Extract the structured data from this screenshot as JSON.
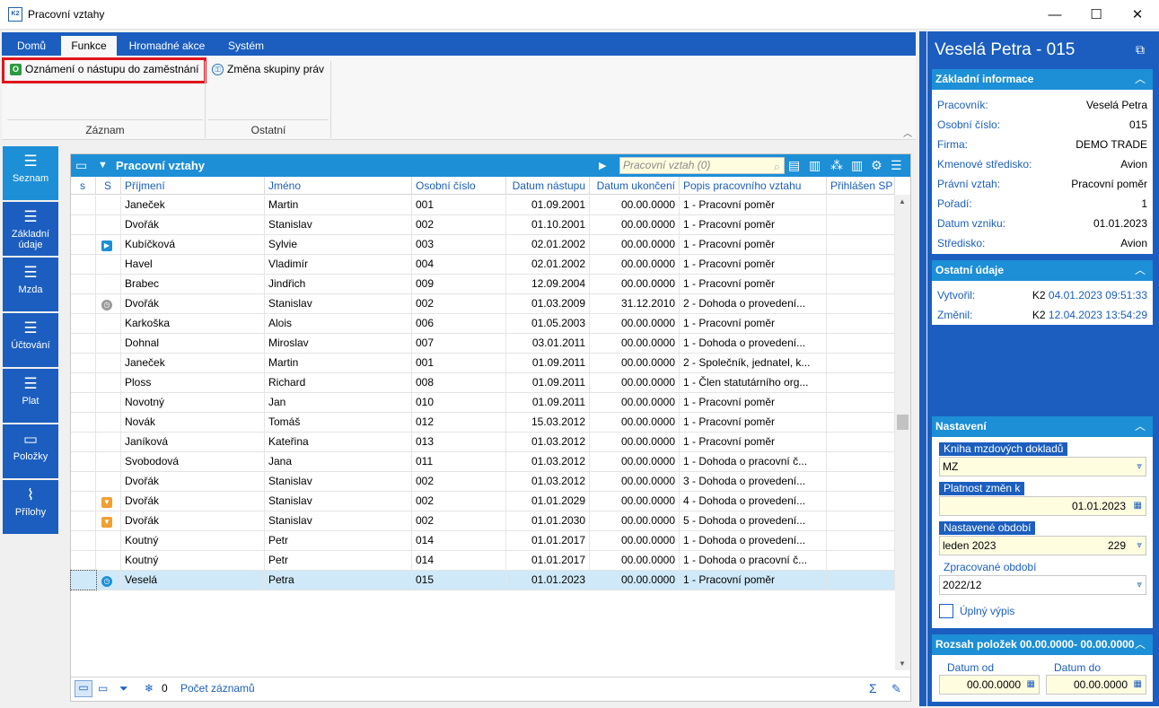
{
  "window": {
    "app_logo": "K2",
    "title": "Pracovní vztahy",
    "controls": [
      "—",
      "☐",
      "✕"
    ]
  },
  "ribbon": {
    "tabs": [
      "Domů",
      "Funkce",
      "Hromadné akce",
      "Systém"
    ],
    "active_tab": "Funkce",
    "buttons": {
      "notice": "Oznámení o nástupu do zaměstnání",
      "notice_icon": "O",
      "rights": "Změna skupiny práv"
    },
    "groups": [
      "Záznam",
      "Ostatní"
    ]
  },
  "leftnav": [
    {
      "label": "Seznam",
      "icon": "list-icon"
    },
    {
      "label": "Základní údaje",
      "icon": "list-icon"
    },
    {
      "label": "Mzda",
      "icon": "list-icon"
    },
    {
      "label": "Účtování",
      "icon": "list-icon"
    },
    {
      "label": "Plat",
      "icon": "list-icon"
    },
    {
      "label": "Položky",
      "icon": "archive-icon"
    },
    {
      "label": "Přílohy",
      "icon": "paperclip-icon"
    }
  ],
  "grid": {
    "title": "Pracovní vztahy",
    "search_placeholder": "Pracovní vztah (0)",
    "columns": [
      "s",
      "S",
      "Příjmení",
      "Jméno",
      "Osobní číslo",
      "Datum nástupu",
      "Datum ukončení",
      "Popis pracovního vztahu",
      "Přihlášen SP"
    ],
    "rows": [
      {
        "s": "",
        "S": "",
        "prijmeni": "Janeček",
        "jmeno": "Martin",
        "osobni": "001",
        "nastup": "01.09.2001",
        "ukonceni": "00.00.0000",
        "popis": "1 - Pracovní poměr"
      },
      {
        "s": "",
        "S": "",
        "prijmeni": "Dvořák",
        "jmeno": "Stanislav",
        "osobni": "002",
        "nastup": "01.10.2001",
        "ukonceni": "00.00.0000",
        "popis": "1 - Pracovní poměr"
      },
      {
        "s": "",
        "S": "play",
        "prijmeni": "Kubíčková",
        "jmeno": "Sylvie",
        "osobni": "003",
        "nastup": "02.01.2002",
        "ukonceni": "00.00.0000",
        "popis": "1 - Pracovní poměr"
      },
      {
        "s": "",
        "S": "",
        "prijmeni": "Havel",
        "jmeno": "Vladimír",
        "osobni": "004",
        "nastup": "02.01.2002",
        "ukonceni": "00.00.0000",
        "popis": "1 - Pracovní poměr"
      },
      {
        "s": "",
        "S": "",
        "prijmeni": "Brabec",
        "jmeno": "Jindřich",
        "osobni": "009",
        "nastup": "12.09.2004",
        "ukonceni": "00.00.0000",
        "popis": "1 - Pracovní poměr"
      },
      {
        "s": "",
        "S": "clock-gray",
        "prijmeni": "Dvořák",
        "jmeno": "Stanislav",
        "osobni": "002",
        "nastup": "01.03.2009",
        "ukonceni": "31.12.2010",
        "popis": "2 - Dohoda o provedení..."
      },
      {
        "s": "",
        "S": "",
        "prijmeni": "Karkoška",
        "jmeno": "Alois",
        "osobni": "006",
        "nastup": "01.05.2003",
        "ukonceni": "00.00.0000",
        "popis": "1 - Pracovní poměr"
      },
      {
        "s": "",
        "S": "",
        "prijmeni": "Dohnal",
        "jmeno": "Miroslav",
        "osobni": "007",
        "nastup": "03.01.2011",
        "ukonceni": "00.00.0000",
        "popis": "1 - Dohoda o provedení..."
      },
      {
        "s": "",
        "S": "",
        "prijmeni": "Janeček",
        "jmeno": "Martin",
        "osobni": "001",
        "nastup": "01.09.2011",
        "ukonceni": "00.00.0000",
        "popis": "2 - Společník, jednatel, k..."
      },
      {
        "s": "",
        "S": "",
        "prijmeni": "Ploss",
        "jmeno": "Richard",
        "osobni": "008",
        "nastup": "01.09.2011",
        "ukonceni": "00.00.0000",
        "popis": "1 - Člen statutárního org..."
      },
      {
        "s": "",
        "S": "",
        "prijmeni": "Novotný",
        "jmeno": "Jan",
        "osobni": "010",
        "nastup": "01.09.2011",
        "ukonceni": "00.00.0000",
        "popis": "1 - Pracovní poměr"
      },
      {
        "s": "",
        "S": "",
        "prijmeni": "Novák",
        "jmeno": "Tomáš",
        "osobni": "012",
        "nastup": "15.03.2012",
        "ukonceni": "00.00.0000",
        "popis": "1 - Pracovní poměr"
      },
      {
        "s": "",
        "S": "",
        "prijmeni": "Janíková",
        "jmeno": "Kateřina",
        "osobni": "013",
        "nastup": "01.03.2012",
        "ukonceni": "00.00.0000",
        "popis": "1 - Pracovní poměr"
      },
      {
        "s": "",
        "S": "",
        "prijmeni": "Svobodová",
        "jmeno": "Jana",
        "osobni": "011",
        "nastup": "01.03.2012",
        "ukonceni": "00.00.0000",
        "popis": "1 - Dohoda o pracovní č..."
      },
      {
        "s": "",
        "S": "",
        "prijmeni": "Dvořák",
        "jmeno": "Stanislav",
        "osobni": "002",
        "nastup": "01.03.2012",
        "ukonceni": "00.00.0000",
        "popis": "3 - Dohoda o provedení..."
      },
      {
        "s": "",
        "S": "down-orange",
        "prijmeni": "Dvořák",
        "jmeno": "Stanislav",
        "osobni": "002",
        "nastup": "01.01.2029",
        "ukonceni": "00.00.0000",
        "popis": "4 - Dohoda o provedení..."
      },
      {
        "s": "",
        "S": "down-orange",
        "prijmeni": "Dvořák",
        "jmeno": "Stanislav",
        "osobni": "002",
        "nastup": "01.01.2030",
        "ukonceni": "00.00.0000",
        "popis": "5 - Dohoda o provedení..."
      },
      {
        "s": "",
        "S": "",
        "prijmeni": "Koutný",
        "jmeno": "Petr",
        "osobni": "014",
        "nastup": "01.01.2017",
        "ukonceni": "00.00.0000",
        "popis": "1 - Dohoda o provedení..."
      },
      {
        "s": "",
        "S": "",
        "prijmeni": "Koutný",
        "jmeno": "Petr",
        "osobni": "014",
        "nastup": "01.01.2017",
        "ukonceni": "00.00.0000",
        "popis": "1 - Dohoda o pracovní č..."
      },
      {
        "s": "",
        "S": "clock-blue",
        "prijmeni": "Veselá",
        "jmeno": "Petra",
        "osobni": "015",
        "nastup": "01.01.2023",
        "ukonceni": "00.00.0000",
        "popis": "1 - Pracovní poměr",
        "selected": true
      }
    ],
    "footer": {
      "filter_count": "0",
      "count_label": "Počet záznamů"
    }
  },
  "panel": {
    "title": "Veselá Petra - 015",
    "basic": {
      "heading": "Základní informace",
      "items": [
        {
          "k": "Pracovník:",
          "v": "Veselá Petra"
        },
        {
          "k": "Osobní číslo:",
          "v": "015"
        },
        {
          "k": "Firma:",
          "v": "DEMO TRADE"
        },
        {
          "k": "Kmenové středisko:",
          "v": "Avion"
        },
        {
          "k": "Právní vztah:",
          "v": "Pracovní poměr"
        },
        {
          "k": "Pořadí:",
          "v": "1"
        },
        {
          "k": "Datum vzniku:",
          "v": "01.01.2023"
        },
        {
          "k": "Středisko:",
          "v": "Avion"
        }
      ]
    },
    "other": {
      "heading": "Ostatní údaje",
      "created_label": "Vytvořil:",
      "created_user": "K2",
      "created_date": "04.01.2023 09:51:33",
      "changed_label": "Změnil:",
      "changed_user": "K2",
      "changed_date": "12.04.2023 13:54:29"
    },
    "settings": {
      "heading": "Nastavení",
      "book_label": "Kniha mzdových dokladů",
      "book_value": "MZ",
      "validity_label": "Platnost změn k",
      "validity_value": "01.01.2023",
      "period_label": "Nastavené období",
      "period_value": "leden 2023",
      "period_num": "229",
      "processed_label": "Zpracované období",
      "processed_value": "2022/12",
      "full_listing_label": "Úplný výpis"
    },
    "range": {
      "heading": "Rozsah položek 00.00.0000- 00.00.0000",
      "from_label": "Datum od",
      "from_value": "00.00.0000",
      "to_label": "Datum do",
      "to_value": "00.00.0000"
    }
  }
}
